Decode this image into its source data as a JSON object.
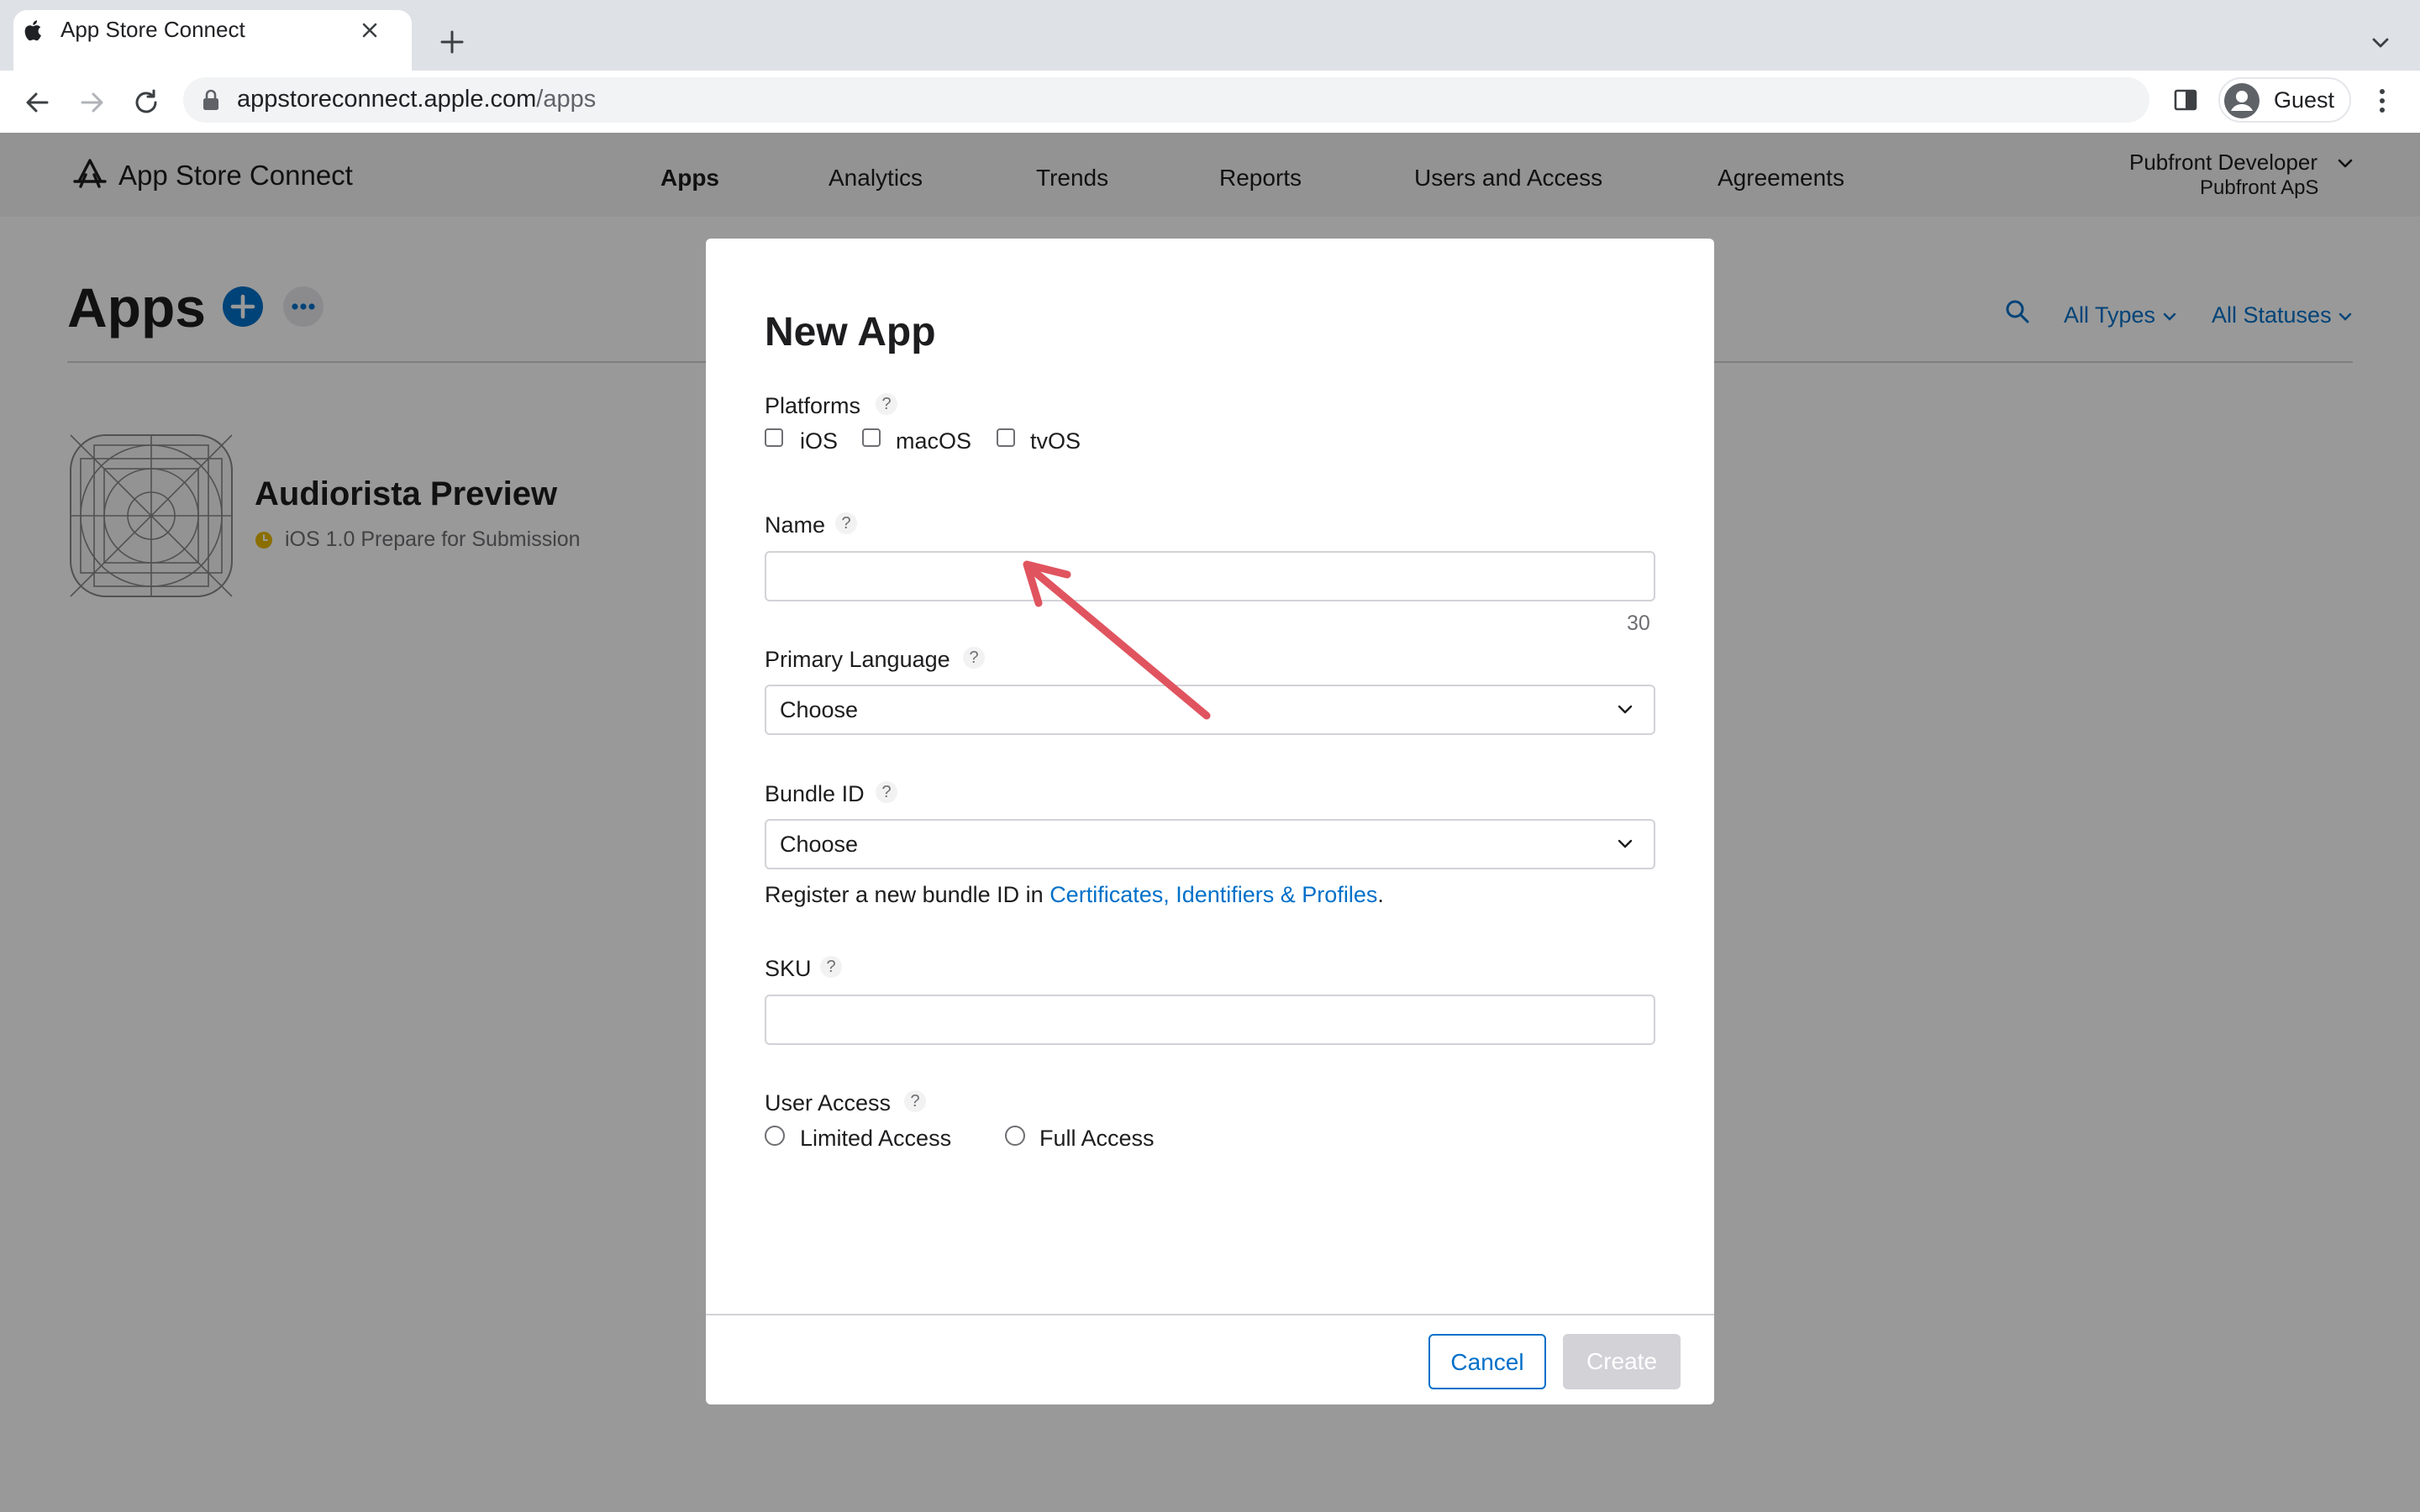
{
  "browser": {
    "tab_title": "App Store Connect",
    "url_host": "appstoreconnect.apple.com",
    "url_path": "/apps",
    "profile_label": "Guest"
  },
  "header": {
    "brand": "App Store Connect",
    "nav": [
      "Apps",
      "Analytics",
      "Trends",
      "Reports",
      "Users and Access",
      "Agreements"
    ],
    "active_nav": "Apps",
    "account_name": "Pubfront Developer",
    "account_org": "Pubfront ApS"
  },
  "page": {
    "title": "Apps",
    "filters": {
      "types": "All Types",
      "statuses": "All Statuses"
    },
    "apps": [
      {
        "name": "Audiorista Preview",
        "status": "iOS 1.0 Prepare for Submission",
        "status_color": "#e8b800"
      }
    ]
  },
  "modal": {
    "title": "New App",
    "platforms": {
      "label": "Platforms",
      "help": "?",
      "options": [
        {
          "label": "iOS",
          "checked": false
        },
        {
          "label": "macOS",
          "checked": false
        },
        {
          "label": "tvOS",
          "checked": false
        }
      ]
    },
    "name": {
      "label": "Name",
      "help": "?",
      "value": "",
      "counter": "30"
    },
    "primary_language": {
      "label": "Primary Language",
      "help": "?",
      "value": "Choose"
    },
    "bundle_id": {
      "label": "Bundle ID",
      "help": "?",
      "value": "Choose",
      "hint_prefix": "Register a new bundle ID in ",
      "hint_link": "Certificates, Identifiers & Profiles",
      "hint_suffix": "."
    },
    "sku": {
      "label": "SKU",
      "help": "?",
      "value": ""
    },
    "user_access": {
      "label": "User Access",
      "help": "?",
      "options": [
        {
          "label": "Limited Access",
          "selected": false
        },
        {
          "label": "Full Access",
          "selected": false
        }
      ]
    },
    "buttons": {
      "cancel": "Cancel",
      "create": "Create"
    }
  },
  "colors": {
    "accent": "#0070c9",
    "annotation_arrow": "#e0545f",
    "create_disabled": "#d2d2d7"
  }
}
